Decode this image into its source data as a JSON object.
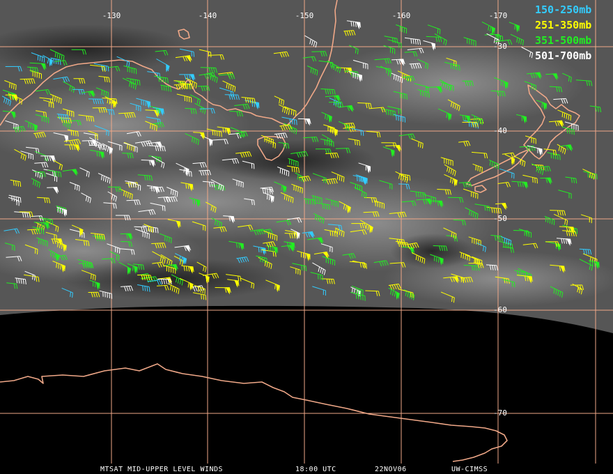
{
  "map": {
    "longitudes": [
      "-130",
      "-140",
      "-150",
      "-160",
      "-170"
    ],
    "latitudes": [
      "-30",
      "-40",
      "-50",
      "-60",
      "-70"
    ]
  },
  "legend": [
    {
      "label": "150-250mb",
      "color": "#33ccff"
    },
    {
      "label": "251-350mb",
      "color": "#ffff00"
    },
    {
      "label": "351-500mb",
      "color": "#22ee22"
    },
    {
      "label": "501-700mb",
      "color": "#ffffff"
    }
  ],
  "footer": {
    "product": "MTSAT MID-UPPER LEVEL WINDS",
    "time": "18:00 UTC",
    "date": "22NOV06",
    "source": "UW-CIMSS"
  },
  "colors": {
    "grid": "#f0a888",
    "coastline": "#f0a888",
    "earth_dark": "#262626",
    "space": "#000000"
  }
}
